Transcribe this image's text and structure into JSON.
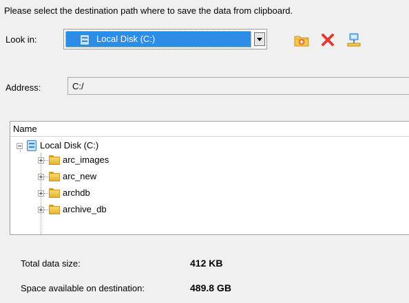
{
  "instruction": "Please select the destination path where to save the data from clipboard.",
  "look_in": {
    "label": "Look in:",
    "selected": "Local Disk (C:)",
    "icon": "disk-icon"
  },
  "toolbar": {
    "new_folder_icon": "new-folder-icon",
    "delete_icon": "delete-icon",
    "network_icon": "network-drive-icon"
  },
  "address": {
    "label": "Address:",
    "value": "C:/"
  },
  "tree": {
    "column_header": "Name",
    "root": {
      "label": "Local Disk (C:)",
      "expanded": true
    },
    "children": [
      {
        "label": "arc_images",
        "expanded": false
      },
      {
        "label": "arc_new",
        "expanded": false
      },
      {
        "label": "archdb",
        "expanded": false
      },
      {
        "label": "archive_db",
        "expanded": false
      }
    ]
  },
  "stats": {
    "total_label": "Total data size:",
    "total_value": "412 KB",
    "space_label": "Space available on destination:",
    "space_value": "489.8 GB"
  },
  "colors": {
    "selection": "#2e8be6",
    "background": "#f0f0f0",
    "folder": "#f2c94c",
    "delete": "#e03c31"
  }
}
